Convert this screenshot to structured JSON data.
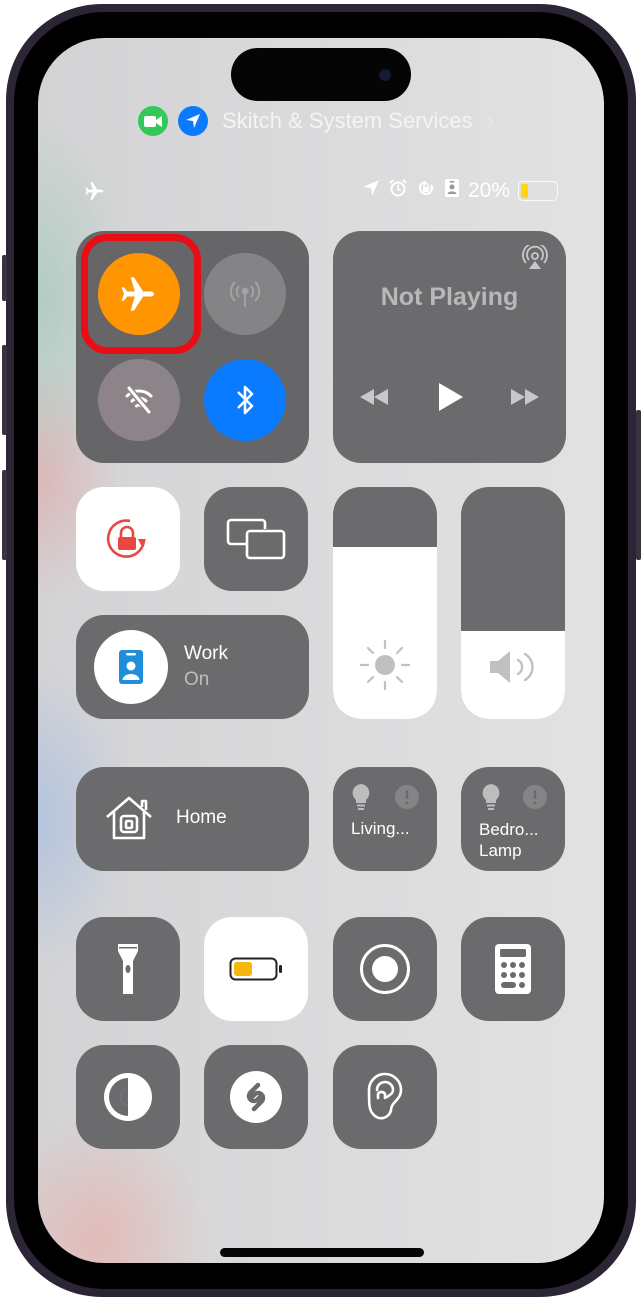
{
  "privacy_indicator": {
    "label": "Skitch & System Services",
    "chevron": "›",
    "icons": [
      "camera-icon",
      "location-arrow-icon"
    ],
    "colors": {
      "camera": "#34c759",
      "location": "#0a7aff"
    }
  },
  "status_bar": {
    "left_icon": "airplane-icon",
    "right_icons": [
      "location-icon",
      "alarm-icon",
      "orientation-lock-icon",
      "work-focus-icon"
    ],
    "battery_percent_text": "20%",
    "battery_level": 0.2,
    "battery_color": "#ffd60a"
  },
  "connectivity": {
    "airplane_mode": {
      "icon": "airplane-icon",
      "on": true,
      "color": "#ff9500"
    },
    "cellular": {
      "icon": "cellular-antenna-icon",
      "on": false
    },
    "wifi": {
      "icon": "wifi-off-icon",
      "on": false
    },
    "bluetooth": {
      "icon": "bluetooth-icon",
      "on": true,
      "color": "#0a7aff"
    },
    "highlight_color": "#ea0d16"
  },
  "now_playing": {
    "title": "Not Playing",
    "airplay_icon": "airplay-audio-icon",
    "controls": [
      "rewind-icon",
      "play-icon",
      "fast-forward-icon"
    ]
  },
  "controls": {
    "orientation_lock": {
      "icon": "orientation-lock-icon",
      "on": true,
      "color": "#e9473f"
    },
    "screen_mirroring": {
      "icon": "screen-mirroring-icon"
    },
    "focus": {
      "title": "Work",
      "status": "On",
      "icon": "work-badge-icon",
      "color": "#1e8fd8"
    },
    "brightness": {
      "icon": "sun-icon",
      "level": 0.74
    },
    "volume": {
      "icon": "speaker-icon",
      "level": 0.38
    },
    "home": {
      "label": "Home",
      "icon": "home-icon"
    },
    "accessories": [
      {
        "name": "Living...",
        "name_line2": "",
        "icon": "lightbulb-icon",
        "status_icon": "exclamation-icon"
      },
      {
        "name": "Bedro...",
        "name_line2": "Lamp",
        "icon": "lightbulb-icon",
        "status_icon": "exclamation-icon"
      }
    ],
    "flashlight": {
      "icon": "flashlight-icon"
    },
    "low_power_mode": {
      "icon": "battery-icon",
      "on": true,
      "color": "#f5b70a"
    },
    "screen_recording": {
      "icon": "record-icon"
    },
    "calculator": {
      "icon": "calculator-icon"
    },
    "dark_mode": {
      "icon": "dark-mode-icon"
    },
    "shazam": {
      "icon": "shazam-icon"
    },
    "hearing": {
      "icon": "ear-icon"
    }
  }
}
